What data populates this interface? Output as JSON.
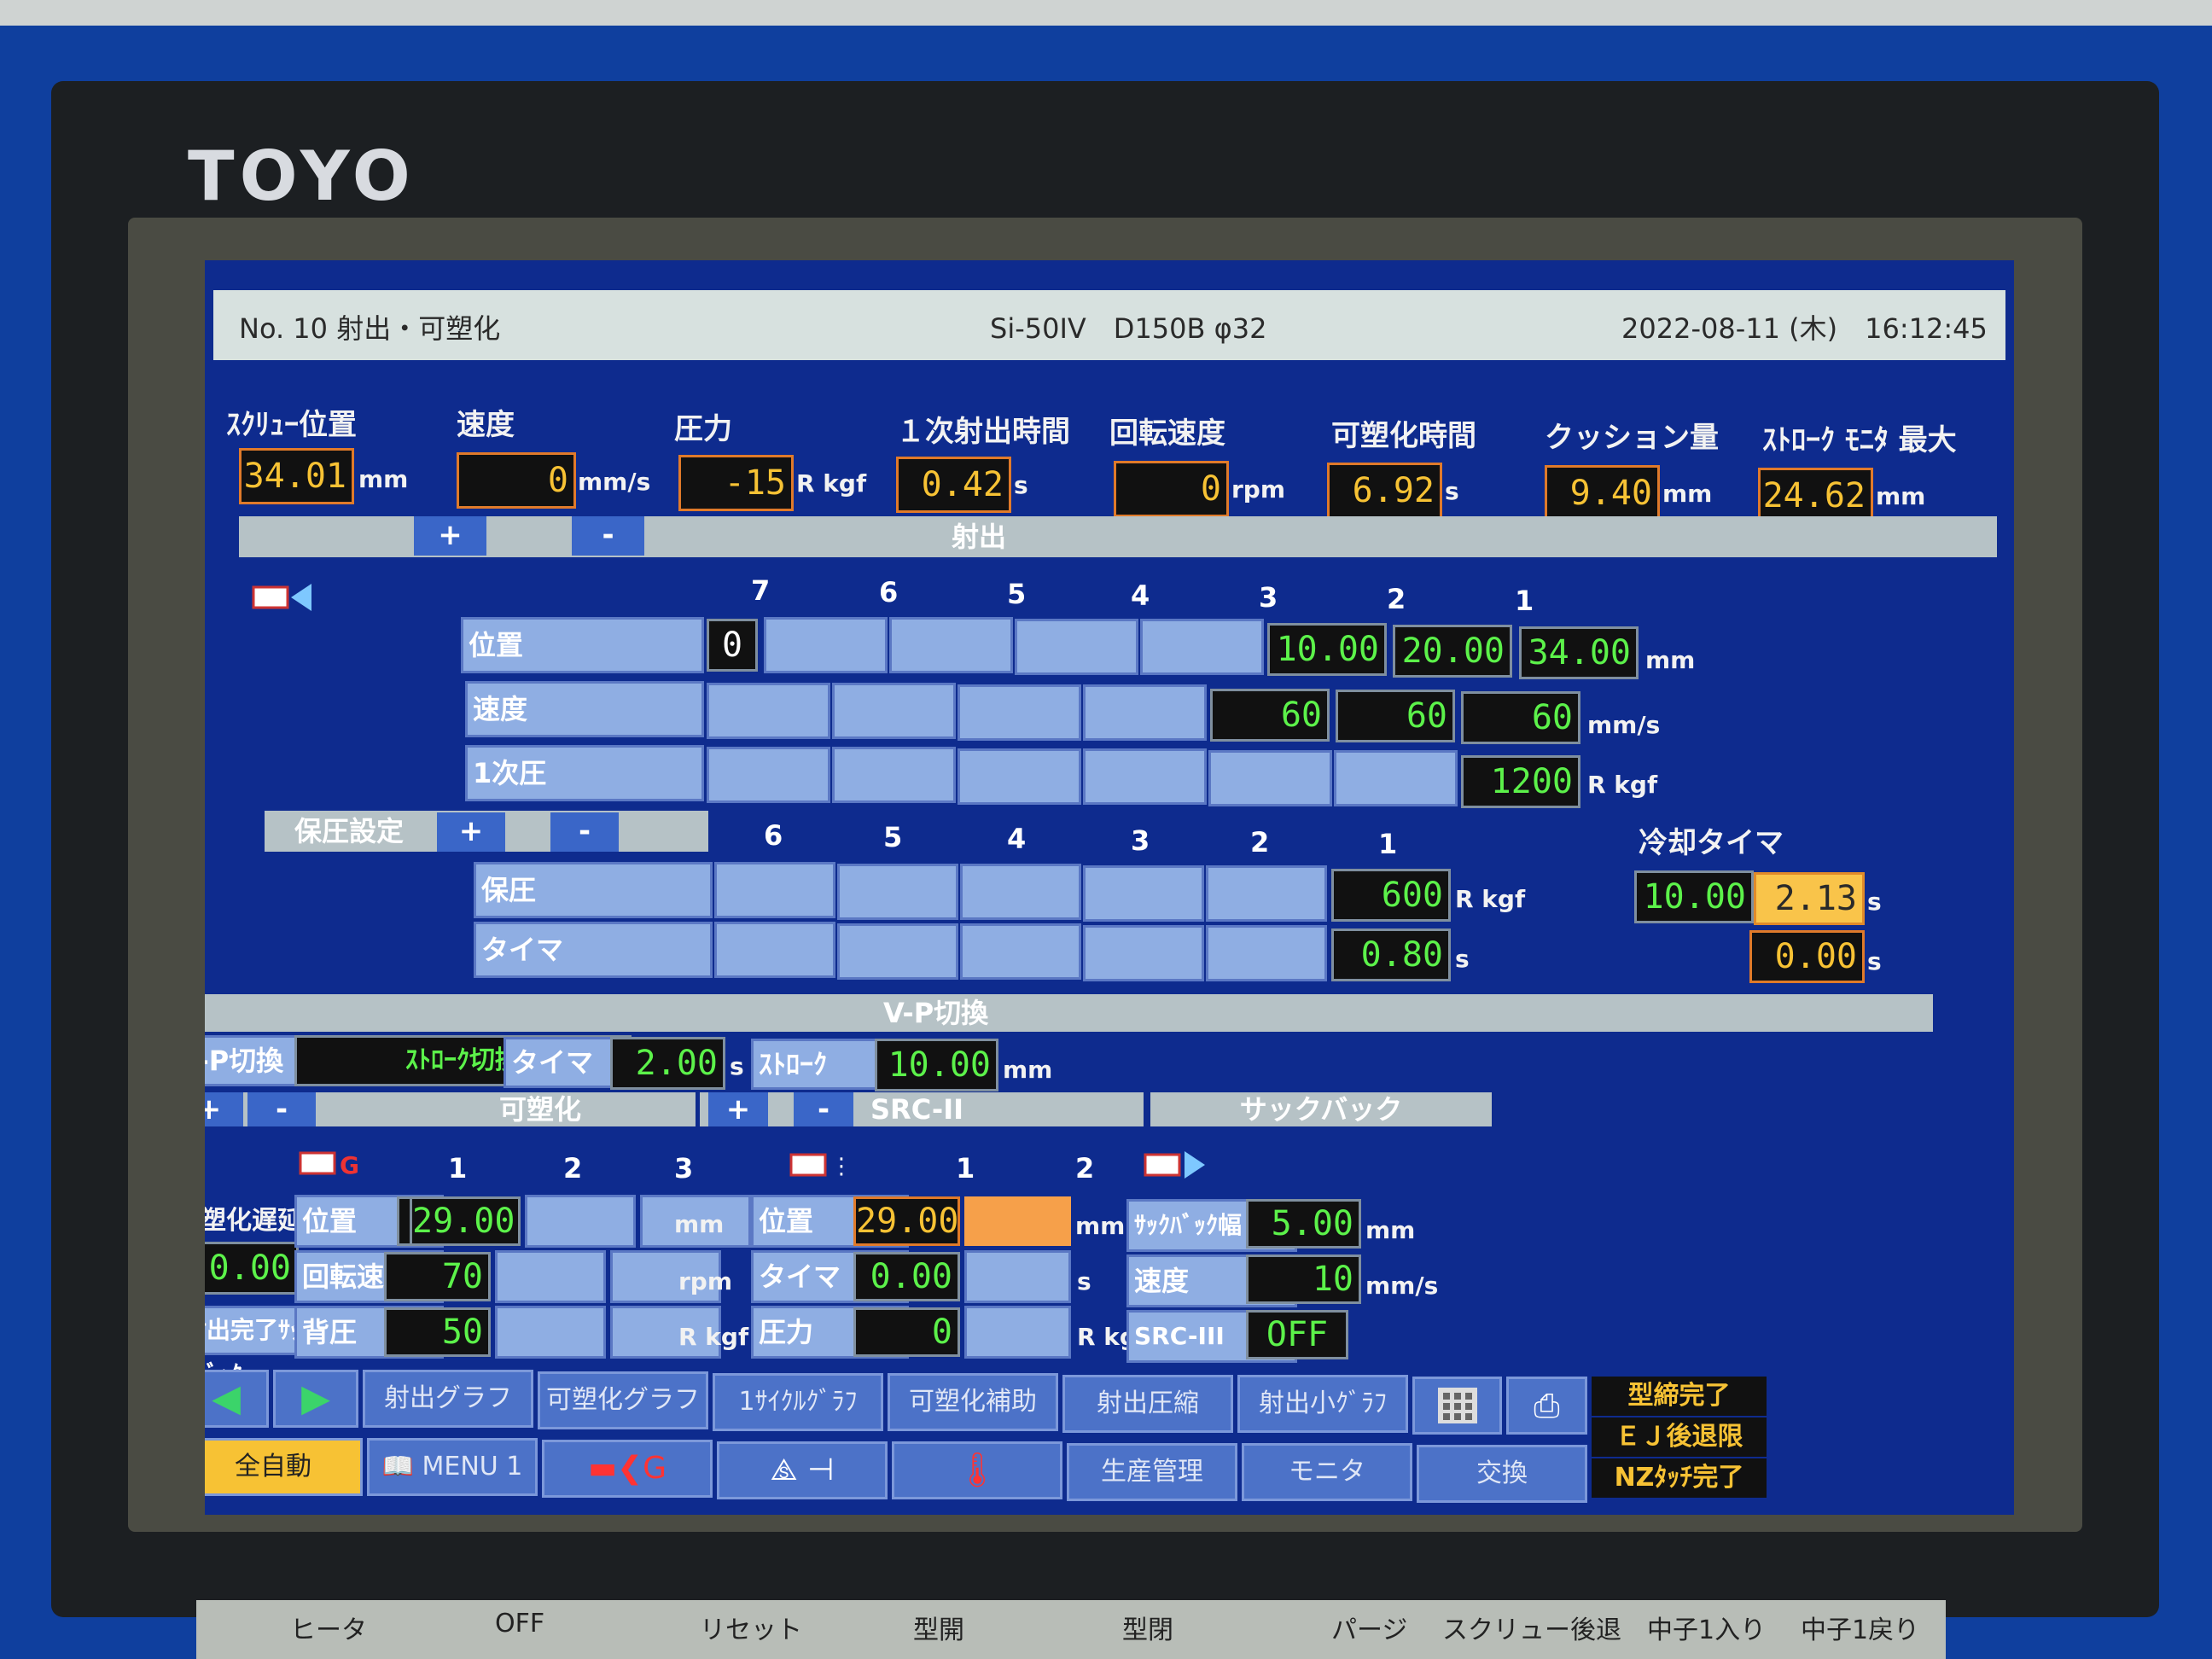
{
  "brand": "TOYO",
  "header": {
    "screen": "No. 10 射出・可塑化",
    "model": "Si-50IV　D150B φ32",
    "datetime": "2022-08-11 (木)　16:12:45"
  },
  "monitors": [
    {
      "label": "ｽｸﾘｭｰ位置",
      "value": "34.01",
      "unit": "mm"
    },
    {
      "label": "速度",
      "value": "0",
      "unit": "mm/s"
    },
    {
      "label": "圧力",
      "value": "-15",
      "unit": "R kgf"
    },
    {
      "label": "１次射出時間",
      "value": "0.42",
      "unit": "s"
    },
    {
      "label": "回転速度",
      "value": "0",
      "unit": "rpm"
    },
    {
      "label": "可塑化時間",
      "value": "6.92",
      "unit": "s"
    },
    {
      "label": "クッション量",
      "value": "9.40",
      "unit": "mm"
    },
    {
      "label": "ｽﾄﾛｰｸ ﾓﾆﾀ 最大",
      "value": "24.62",
      "unit": "mm"
    }
  ],
  "plus": "+",
  "minus": "-",
  "injection": {
    "title": "射出",
    "cols": [
      "7",
      "6",
      "5",
      "4",
      "3",
      "2",
      "1"
    ],
    "pos_label": "位置",
    "pos_start": "0",
    "pos_vals": [
      "10.00",
      "20.00",
      "34.00"
    ],
    "pos_unit": "mm",
    "speed_label": "速度",
    "speed_vals": [
      "60",
      "60",
      "60"
    ],
    "speed_unit": "mm/s",
    "p1_label": "1次圧",
    "p1_val": "1200",
    "p1_unit": "R kgf"
  },
  "hold": {
    "title": "保圧設定",
    "cols": [
      "6",
      "5",
      "4",
      "3",
      "2",
      "1"
    ],
    "p_label": "保圧",
    "p_val": "600",
    "p_unit": "R kgf",
    "t_label": "タイマ",
    "t_val": "0.80",
    "t_unit": "s",
    "cool_title": "冷却タイマ",
    "cool_set": "10.00",
    "cool_act": "2.13",
    "cool_unit": "s",
    "cool2": "0.00",
    "cool2_unit": "s"
  },
  "vp": {
    "title": "V-P切換",
    "label": "V-P切換",
    "mode": "ｽﾄﾛｰｸ切換",
    "timer_label": "タイマ",
    "timer_val": "2.00",
    "timer_unit": "s",
    "stroke_label": "ｽﾄﾛｰｸ",
    "stroke_val": "10.00",
    "stroke_unit": "mm"
  },
  "plast": {
    "title": "可塑化",
    "cols": [
      "1",
      "2",
      "3"
    ],
    "delay_label": "可塑化遅延時間",
    "delay_val": "0.00",
    "delay_unit": "s",
    "complete_label": "射出完了ｻｯｸﾊﾞｯｸ",
    "pos_label": "位置",
    "pos_start": "0",
    "pos_val": "29.00",
    "pos_unit": "mm",
    "rot_label": "回転速度",
    "rot_val": "70",
    "rot_unit": "rpm",
    "bp_label": "背圧",
    "bp_val": "50",
    "bp_unit": "R kgf"
  },
  "src": {
    "title": "SRC-II",
    "cols": [
      "1",
      "2"
    ],
    "pos_label": "位置",
    "pos_val": "29.00",
    "pos_unit": "mm",
    "t_label": "タイマ",
    "t_val": "0.00",
    "t_unit": "s",
    "p_label": "圧力",
    "p_val": "0",
    "p_unit": "R kgf"
  },
  "suck": {
    "title": "サックバック",
    "w_label": "ｻｯｸﾊﾞｯｸ幅",
    "w_val": "5.00",
    "w_unit": "mm",
    "s_label": "速度",
    "s_val": "10",
    "s_unit": "mm/s",
    "src3_label": "SRC-III",
    "src3_val": "OFF"
  },
  "menu1": [
    "射出グラフ",
    "可塑化グラフ",
    "1ｻｲｸﾙｸﾞﾗﾌ",
    "可塑化補助",
    "射出圧縮",
    "射出小ｸﾞﾗﾌ"
  ],
  "menu2": {
    "mode": "全自動",
    "menu": "MENU 1",
    "prod": "生産管理",
    "monitor": "モニタ",
    "exchange": "交換"
  },
  "status": [
    "型締完了",
    "ＥＪ後退限",
    "NZﾀｯﾁ完了"
  ],
  "panel_keys": [
    "ヒータ",
    "OFF",
    "リセット",
    "型開",
    "型閉",
    "パージ",
    "スクリュー後退",
    "中子1入り",
    "中子1戻り"
  ]
}
